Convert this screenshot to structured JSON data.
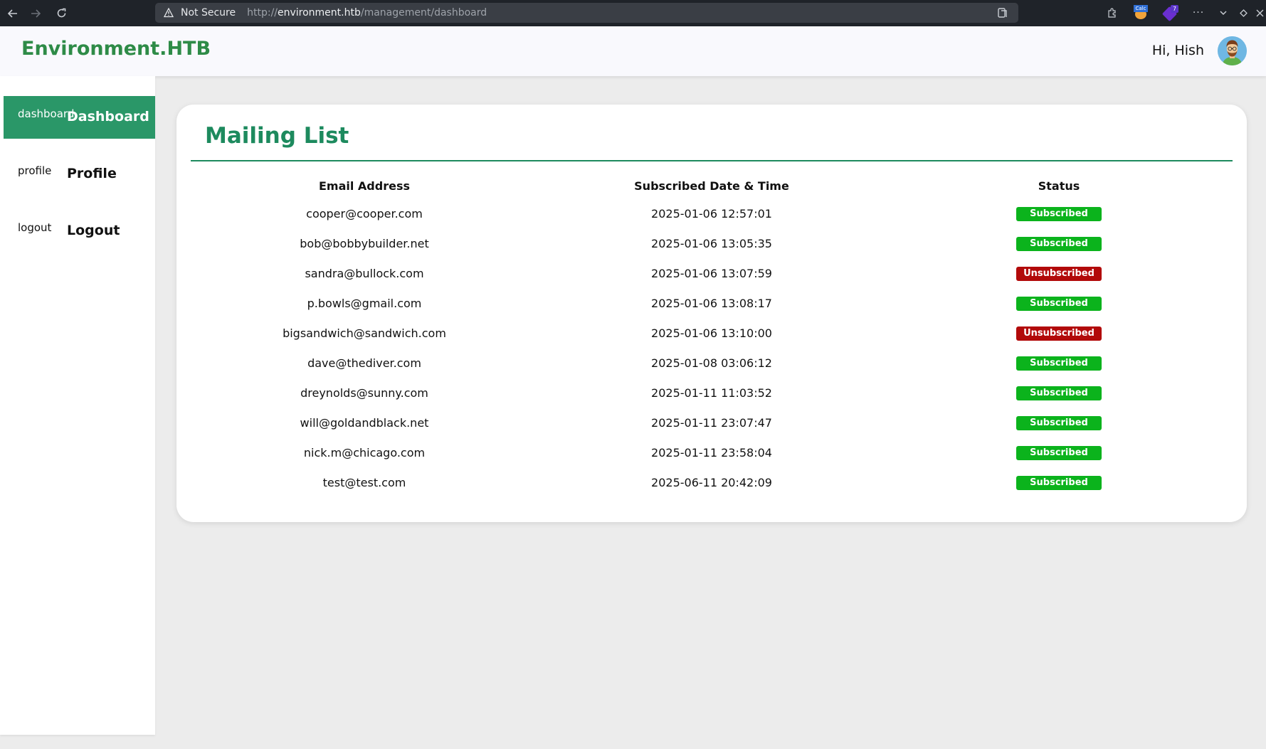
{
  "browser": {
    "security_label": "Not Secure",
    "url_scheme": "http://",
    "url_host": "environment.htb",
    "url_path": "/management/dashboard",
    "extension_badge_text": "Calc",
    "extension_count": "7"
  },
  "header": {
    "brand": "Environment.HTB",
    "greeting": "Hi, Hish"
  },
  "sidebar": {
    "items": [
      {
        "icon_text": "dashboard",
        "label": "Dashboard",
        "active": true
      },
      {
        "icon_text": "profile",
        "label": "Profile",
        "active": false
      },
      {
        "icon_text": "logout",
        "label": "Logout",
        "active": false
      }
    ]
  },
  "main": {
    "title": "Mailing List",
    "columns": [
      "Email Address",
      "Subscribed Date & Time",
      "Status"
    ],
    "rows": [
      {
        "email": "cooper@cooper.com",
        "datetime": "2025-01-06 12:57:01",
        "status": "Subscribed"
      },
      {
        "email": "bob@bobbybuilder.net",
        "datetime": "2025-01-06 13:05:35",
        "status": "Subscribed"
      },
      {
        "email": "sandra@bullock.com",
        "datetime": "2025-01-06 13:07:59",
        "status": "Unsubscribed"
      },
      {
        "email": "p.bowls@gmail.com",
        "datetime": "2025-01-06 13:08:17",
        "status": "Subscribed"
      },
      {
        "email": "bigsandwich@sandwich.com",
        "datetime": "2025-01-06 13:10:00",
        "status": "Unsubscribed"
      },
      {
        "email": "dave@thediver.com",
        "datetime": "2025-01-08 03:06:12",
        "status": "Subscribed"
      },
      {
        "email": "dreynolds@sunny.com",
        "datetime": "2025-01-11 11:03:52",
        "status": "Subscribed"
      },
      {
        "email": "will@goldandblack.net",
        "datetime": "2025-01-11 23:07:47",
        "status": "Subscribed"
      },
      {
        "email": "nick.m@chicago.com",
        "datetime": "2025-01-11 23:58:04",
        "status": "Subscribed"
      },
      {
        "email": "test@test.com",
        "datetime": "2025-06-11 20:42:09",
        "status": "Subscribed"
      }
    ]
  },
  "colors": {
    "brand_green": "#2e8b47",
    "accent_green": "#1d8a5e",
    "sidebar_active": "#2a9768",
    "subscribed": "#0bb31c",
    "unsubscribed": "#b20a0a"
  }
}
